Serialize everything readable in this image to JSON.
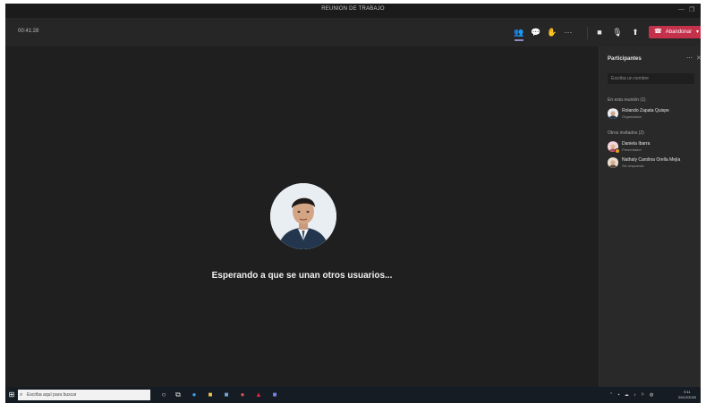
{
  "window": {
    "title": "REUNION DE TRABAJO",
    "minimize_glyph": "—",
    "maximize_glyph": "❐"
  },
  "toolbar": {
    "timer": "00:41:28",
    "icons": [
      "participants-icon",
      "chat-icon",
      "raise-hand-icon",
      "more-icon",
      "camera-icon",
      "mic-icon",
      "share-icon"
    ],
    "leave_label": "Abandonar"
  },
  "stage": {
    "waiting_text": "Esperando a que se unan otros usuarios..."
  },
  "participants": {
    "title": "Participantes",
    "invite_placeholder": "Escriba un nombre",
    "in_meeting_header": "En esta reunión (1)",
    "others_header": "Otros invitados (2)",
    "in_meeting": [
      {
        "name": "Rolando Zapata Quispe",
        "role": "Organizador"
      }
    ],
    "others": [
      {
        "name": "Daniela Ibarra",
        "role": "Presentador"
      },
      {
        "name": "Nathaly Carolina Orella Mejía",
        "role": "Sin respuesta"
      }
    ]
  },
  "taskbar": {
    "search_placeholder": "Escriba aquí para buscar",
    "time": "9:11",
    "date": "29/12/2020"
  },
  "colors": {
    "accent": "#8b8cc7",
    "leave": "#c4314b",
    "background": "#1f1f1f"
  }
}
